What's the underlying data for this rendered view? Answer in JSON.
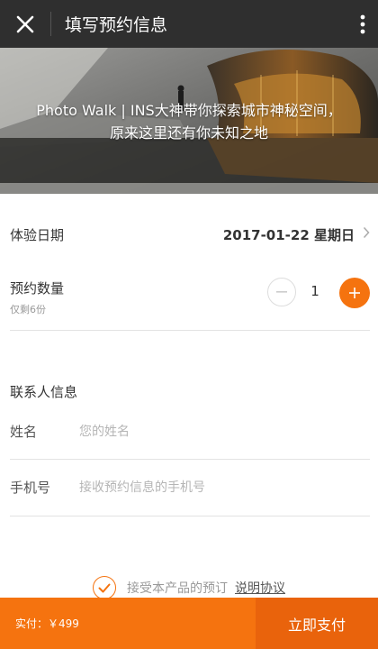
{
  "header": {
    "title": "填写预约信息"
  },
  "hero": {
    "caption": "Photo Walk | INS大神带你探索城市神秘空间，原来这里还有你未知之地"
  },
  "booking": {
    "date_label": "体验日期",
    "date_value": "2017-01-22 星期日",
    "qty_label": "预约数量",
    "qty_remaining": "仅剩6份",
    "qty_value": "1"
  },
  "contact": {
    "section_title": "联系人信息",
    "name_label": "姓名",
    "name_placeholder": "您的姓名",
    "phone_label": "手机号",
    "phone_placeholder": "接收预约信息的手机号"
  },
  "agreement": {
    "text": "接受本产品的预订",
    "link": "说明协议",
    "checked": true
  },
  "footer": {
    "price": "实付：￥499",
    "pay_label": "立即支付"
  },
  "colors": {
    "accent": "#f5730f",
    "header_bg": "#2f2f2f"
  }
}
